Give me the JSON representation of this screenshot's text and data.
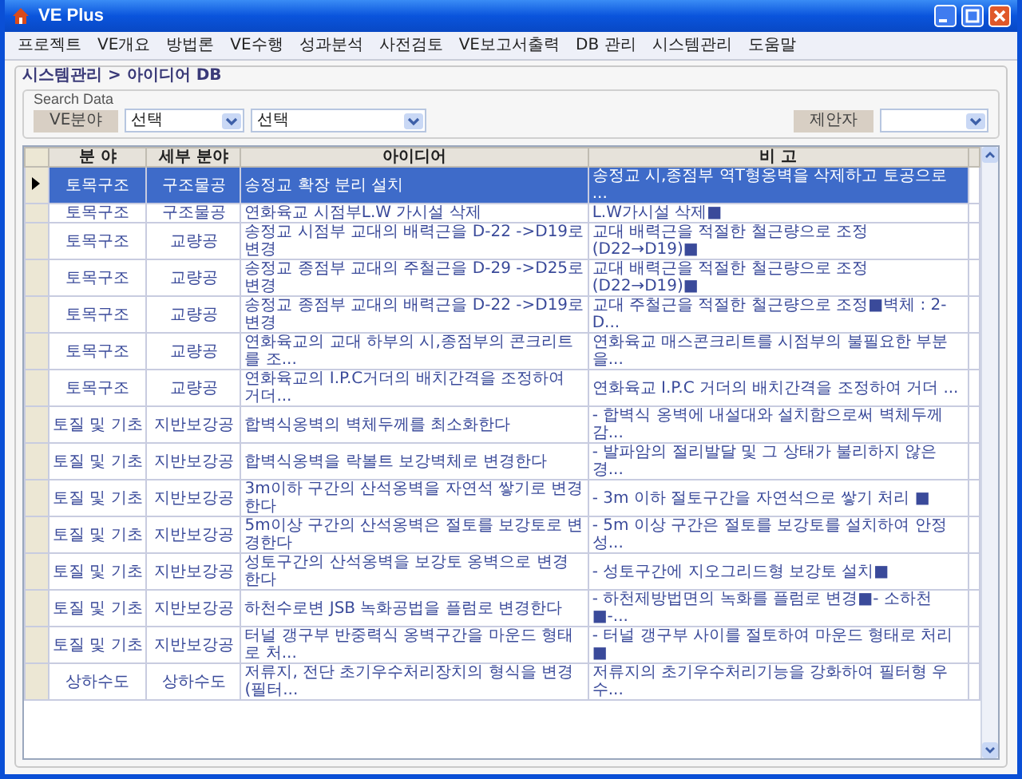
{
  "window": {
    "title": "VE Plus"
  },
  "menu": [
    "프로젝트",
    "VE개요",
    "방법론",
    "VE수행",
    "성과분석",
    "사전검토",
    "VE보고서출력",
    "DB 관리",
    "시스템관리",
    "도움말"
  ],
  "breadcrumb": "시스템관리 > 아이디어 DB",
  "search": {
    "title": "Search Data",
    "field_label": "VE분야",
    "selects": [
      {
        "value": "선택"
      },
      {
        "value": "선택"
      }
    ],
    "proposer_label": "제안자"
  },
  "table": {
    "columns": [
      "분 야",
      "세부 분야",
      "아이디어",
      "비 고"
    ],
    "rows": [
      {
        "selected": true,
        "cells": [
          "토목구조",
          "구조물공",
          "송정교 확장 분리 설치",
          "송정교 시,종점부 역T형옹벽을 삭제하고 토공으로 ..."
        ]
      },
      {
        "selected": false,
        "cells": [
          "토목구조",
          "구조물공",
          "연화육교 시점부L.W 가시설 삭제",
          "L.W가시설 삭제■"
        ]
      },
      {
        "selected": false,
        "cells": [
          "토목구조",
          "교량공",
          "송정교 시점부 교대의 배력근을 D-22 ->D19로 변경",
          "교대 배력근을 적절한 철근량으로 조정(D22→D19)■"
        ]
      },
      {
        "selected": false,
        "cells": [
          "토목구조",
          "교량공",
          "송정교 종점부 교대의 주철근을 D-29 ->D25로 변경",
          "교대 배력근을 적절한 철근량으로 조정(D22→D19)■"
        ]
      },
      {
        "selected": false,
        "cells": [
          "토목구조",
          "교량공",
          "송정교 종점부 교대의 배력근을 D-22 ->D19로 변경",
          "교대 주철근을 적절한 철근량으로 조정■벽체 : 2-D..."
        ]
      },
      {
        "selected": false,
        "cells": [
          "토목구조",
          "교량공",
          "연화육교의 교대 하부의 시,종점부의 콘크리트를 조...",
          "연화육교 매스콘크리트를 시점부의 불필요한 부분을..."
        ]
      },
      {
        "selected": false,
        "cells": [
          "토목구조",
          "교량공",
          "연화육교의 I.P.C거더의 배치간격을 조정하여 거더...",
          "연화육교 I.P.C 거더의 배치간격을 조정하여 거더 ..."
        ]
      },
      {
        "selected": false,
        "cells": [
          "토질 및 기초",
          "지반보강공",
          "합벽식옹벽의 벽체두께를 최소화한다",
          "- 합벽식 옹벽에 내설대와 설치함으로써 벽체두께 감..."
        ]
      },
      {
        "selected": false,
        "cells": [
          "토질 및 기초",
          "지반보강공",
          "합벽식옹벽을 락볼트 보강벽체로 변경한다",
          "- 발파암의 절리발달 및 그 상태가 불리하지 않은 경..."
        ]
      },
      {
        "selected": false,
        "cells": [
          "토질 및 기초",
          "지반보강공",
          "3m이하 구간의 산석옹벽을 자연석 쌓기로 변경한다",
          "- 3m 이하 절토구간을 자연석으로 쌓기 처리 ■"
        ]
      },
      {
        "selected": false,
        "cells": [
          "토질 및 기초",
          "지반보강공",
          "5m이상 구간의 산석옹벽은 절토를 보강토로 변경한다",
          "- 5m 이상 구간은 절토를 보강토를 설치하여 안정성..."
        ]
      },
      {
        "selected": false,
        "cells": [
          "토질 및 기초",
          "지반보강공",
          "성토구간의 산석옹벽을 보강토 옹벽으로 변경한다",
          "- 성토구간에 지오그리드형 보강토 설치■"
        ]
      },
      {
        "selected": false,
        "cells": [
          "토질 및 기초",
          "지반보강공",
          "하천수로변 JSB 녹화공법을 플럼로 변경한다",
          "- 하천제방법면의 녹화를 플럼로 변경■- 소하천■-..."
        ]
      },
      {
        "selected": false,
        "cells": [
          "토질 및 기초",
          "지반보강공",
          "터널 갱구부 반중력식 옹벽구간을 마운드 형태로 처...",
          "- 터널 갱구부 사이를 절토하여 마운드 형태로 처리■"
        ]
      },
      {
        "selected": false,
        "cells": [
          "상하수도",
          "상하수도",
          "저류지, 전단 초기우수처리장치의 형식을 변경(필터...",
          "저류지의 초기우수처리기능을 강화하여 필터형 우수..."
        ]
      }
    ]
  }
}
